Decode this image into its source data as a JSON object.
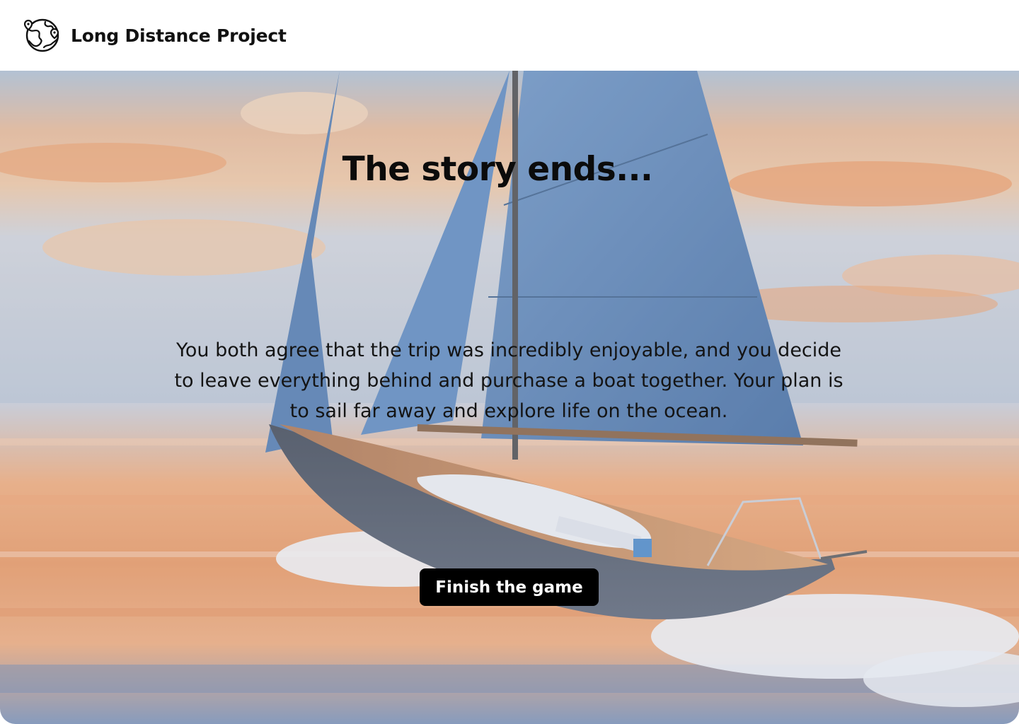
{
  "app": {
    "name": "Long Distance Project",
    "logo_icon": "globe-with-pins-icon"
  },
  "scene": {
    "image": "sailboat-at-sunset-painting"
  },
  "ending": {
    "title": "The story ends...",
    "text": "You both agree that the trip was incredibly enjoyable, and you decide to leave everything behind and purchase a boat together. Your plan is to sail far away and explore life on the ocean.",
    "button_label": "Finish the game"
  },
  "colors": {
    "button_bg": "#000000",
    "button_text": "#ffffff",
    "sail": "#3f6ea8",
    "sunset": "#f0934a",
    "sea": "#6f8fb8"
  }
}
